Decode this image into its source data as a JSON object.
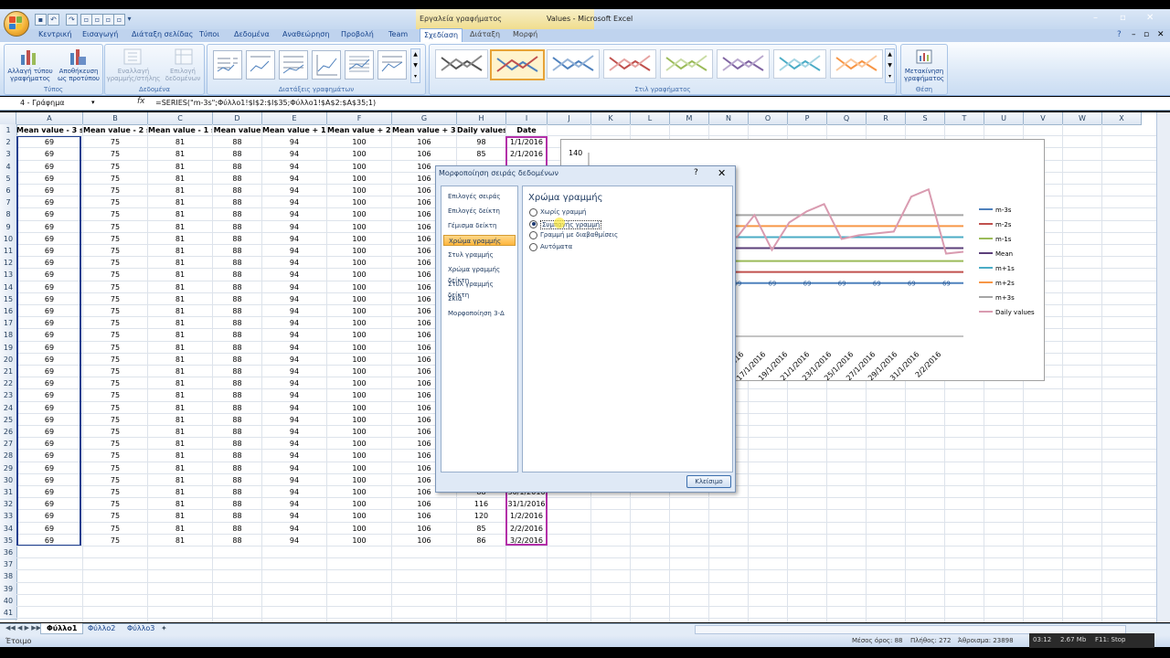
{
  "window": {
    "title": "Values - Microsoft Excel",
    "chart_tools_label": "Εργαλεία γραφήματος"
  },
  "tabs": [
    {
      "label": "Κεντρική"
    },
    {
      "label": "Εισαγωγή"
    },
    {
      "label": "Διάταξη σελίδας"
    },
    {
      "label": "Τύποι"
    },
    {
      "label": "Δεδομένα"
    },
    {
      "label": "Αναθεώρηση"
    },
    {
      "label": "Προβολή"
    },
    {
      "label": "Team"
    },
    {
      "label": "Σχεδίαση"
    },
    {
      "label": "Διάταξη"
    },
    {
      "label": "Μορφή"
    }
  ],
  "ribbon": {
    "type_group": {
      "label": "Τύπος",
      "change_type": "Αλλαγή τύπου γραφήματος",
      "save_template": "Αποθήκευση ως προτύπου"
    },
    "data_group": {
      "label": "Δεδομένα",
      "switch": "Εναλλαγή γραμμής/στήλης",
      "select": "Επιλογή δεδομένων"
    },
    "layouts_label": "Διατάξεις γραφημάτων",
    "styles_label": "Στιλ γραφήματος",
    "location_group": {
      "label": "Θέση",
      "move": "Μετακίνηση γραφήματος"
    }
  },
  "formula_bar": {
    "name_box": "4 - Γράφημα",
    "fx": "fx",
    "formula": "=SERIES(\"m-3s\";Φύλλο1!$I$2:$I$35;Φύλλο1!$A$2:$A$35;1)"
  },
  "sheet": {
    "columns": [
      "A",
      "B",
      "C",
      "D",
      "E",
      "F",
      "G",
      "H",
      "I",
      "J",
      "K",
      "L",
      "M",
      "N",
      "O",
      "P",
      "Q",
      "R",
      "S",
      "T",
      "U",
      "V",
      "W",
      "X"
    ],
    "headers": [
      "Mean value - 3 s",
      "Mean value - 2 s",
      "Mean value - 1 s",
      "Mean value",
      "Mean value + 1 s",
      "Mean value + 2 s",
      "Mean value + 3 s",
      "Daily values",
      "Date"
    ],
    "rows": [
      {
        "n": "2",
        "a": "69",
        "b": "75",
        "c": "81",
        "d": "88",
        "e": "94",
        "f": "100",
        "g": "106",
        "h": "98",
        "i": "1/1/2016"
      },
      {
        "n": "3",
        "a": "69",
        "b": "75",
        "c": "81",
        "d": "88",
        "e": "94",
        "f": "100",
        "g": "106",
        "h": "85",
        "i": "2/1/2016"
      },
      {
        "n": "4",
        "a": "69",
        "b": "75",
        "c": "81",
        "d": "88",
        "e": "94",
        "f": "100",
        "g": "106",
        "h": "",
        "i": ""
      },
      {
        "n": "5",
        "a": "69",
        "b": "75",
        "c": "81",
        "d": "88",
        "e": "94",
        "f": "100",
        "g": "106",
        "h": "",
        "i": ""
      },
      {
        "n": "6",
        "a": "69",
        "b": "75",
        "c": "81",
        "d": "88",
        "e": "94",
        "f": "100",
        "g": "106",
        "h": "",
        "i": ""
      },
      {
        "n": "7",
        "a": "69",
        "b": "75",
        "c": "81",
        "d": "88",
        "e": "94",
        "f": "100",
        "g": "106",
        "h": "",
        "i": ""
      },
      {
        "n": "8",
        "a": "69",
        "b": "75",
        "c": "81",
        "d": "88",
        "e": "94",
        "f": "100",
        "g": "106",
        "h": "",
        "i": ""
      },
      {
        "n": "9",
        "a": "69",
        "b": "75",
        "c": "81",
        "d": "88",
        "e": "94",
        "f": "100",
        "g": "106",
        "h": "",
        "i": ""
      },
      {
        "n": "10",
        "a": "69",
        "b": "75",
        "c": "81",
        "d": "88",
        "e": "94",
        "f": "100",
        "g": "106",
        "h": "",
        "i": ""
      },
      {
        "n": "11",
        "a": "69",
        "b": "75",
        "c": "81",
        "d": "88",
        "e": "94",
        "f": "100",
        "g": "106",
        "h": "",
        "i": ""
      },
      {
        "n": "12",
        "a": "69",
        "b": "75",
        "c": "81",
        "d": "88",
        "e": "94",
        "f": "100",
        "g": "106",
        "h": "",
        "i": ""
      },
      {
        "n": "13",
        "a": "69",
        "b": "75",
        "c": "81",
        "d": "88",
        "e": "94",
        "f": "100",
        "g": "106",
        "h": "",
        "i": ""
      },
      {
        "n": "14",
        "a": "69",
        "b": "75",
        "c": "81",
        "d": "88",
        "e": "94",
        "f": "100",
        "g": "106",
        "h": "",
        "i": ""
      },
      {
        "n": "15",
        "a": "69",
        "b": "75",
        "c": "81",
        "d": "88",
        "e": "94",
        "f": "100",
        "g": "106",
        "h": "",
        "i": ""
      },
      {
        "n": "16",
        "a": "69",
        "b": "75",
        "c": "81",
        "d": "88",
        "e": "94",
        "f": "100",
        "g": "106",
        "h": "",
        "i": ""
      },
      {
        "n": "17",
        "a": "69",
        "b": "75",
        "c": "81",
        "d": "88",
        "e": "94",
        "f": "100",
        "g": "106",
        "h": "",
        "i": ""
      },
      {
        "n": "18",
        "a": "69",
        "b": "75",
        "c": "81",
        "d": "88",
        "e": "94",
        "f": "100",
        "g": "106",
        "h": "",
        "i": ""
      },
      {
        "n": "19",
        "a": "69",
        "b": "75",
        "c": "81",
        "d": "88",
        "e": "94",
        "f": "100",
        "g": "106",
        "h": "",
        "i": ""
      },
      {
        "n": "20",
        "a": "69",
        "b": "75",
        "c": "81",
        "d": "88",
        "e": "94",
        "f": "100",
        "g": "106",
        "h": "",
        "i": ""
      },
      {
        "n": "21",
        "a": "69",
        "b": "75",
        "c": "81",
        "d": "88",
        "e": "94",
        "f": "100",
        "g": "106",
        "h": "",
        "i": ""
      },
      {
        "n": "22",
        "a": "69",
        "b": "75",
        "c": "81",
        "d": "88",
        "e": "94",
        "f": "100",
        "g": "106",
        "h": "",
        "i": ""
      },
      {
        "n": "23",
        "a": "69",
        "b": "75",
        "c": "81",
        "d": "88",
        "e": "94",
        "f": "100",
        "g": "106",
        "h": "",
        "i": ""
      },
      {
        "n": "24",
        "a": "69",
        "b": "75",
        "c": "81",
        "d": "88",
        "e": "94",
        "f": "100",
        "g": "106",
        "h": "",
        "i": ""
      },
      {
        "n": "25",
        "a": "69",
        "b": "75",
        "c": "81",
        "d": "88",
        "e": "94",
        "f": "100",
        "g": "106",
        "h": "",
        "i": ""
      },
      {
        "n": "26",
        "a": "69",
        "b": "75",
        "c": "81",
        "d": "88",
        "e": "94",
        "f": "100",
        "g": "106",
        "h": "",
        "i": ""
      },
      {
        "n": "27",
        "a": "69",
        "b": "75",
        "c": "81",
        "d": "88",
        "e": "94",
        "f": "100",
        "g": "106",
        "h": "",
        "i": ""
      },
      {
        "n": "28",
        "a": "69",
        "b": "75",
        "c": "81",
        "d": "88",
        "e": "94",
        "f": "100",
        "g": "106",
        "h": "",
        "i": ""
      },
      {
        "n": "29",
        "a": "69",
        "b": "75",
        "c": "81",
        "d": "88",
        "e": "94",
        "f": "100",
        "g": "106",
        "h": "",
        "i": ""
      },
      {
        "n": "30",
        "a": "69",
        "b": "75",
        "c": "81",
        "d": "88",
        "e": "94",
        "f": "100",
        "g": "106",
        "h": "",
        "i": ""
      },
      {
        "n": "31",
        "a": "69",
        "b": "75",
        "c": "81",
        "d": "88",
        "e": "94",
        "f": "100",
        "g": "106",
        "h": "88",
        "i": "30/1/2016"
      },
      {
        "n": "32",
        "a": "69",
        "b": "75",
        "c": "81",
        "d": "88",
        "e": "94",
        "f": "100",
        "g": "106",
        "h": "116",
        "i": "31/1/2016"
      },
      {
        "n": "33",
        "a": "69",
        "b": "75",
        "c": "81",
        "d": "88",
        "e": "94",
        "f": "100",
        "g": "106",
        "h": "120",
        "i": "1/2/2016"
      },
      {
        "n": "34",
        "a": "69",
        "b": "75",
        "c": "81",
        "d": "88",
        "e": "94",
        "f": "100",
        "g": "106",
        "h": "85",
        "i": "2/2/2016"
      },
      {
        "n": "35",
        "a": "69",
        "b": "75",
        "c": "81",
        "d": "88",
        "e": "94",
        "f": "100",
        "g": "106",
        "h": "86",
        "i": "3/2/2016"
      }
    ],
    "empty_rows": [
      "36",
      "37",
      "38",
      "39",
      "40",
      "41"
    ]
  },
  "chart_data": {
    "type": "line",
    "y_tick_visible": "140",
    "x_tick_labels": [
      "15/1/2016",
      "17/1/2016",
      "19/1/2016",
      "21/1/2016",
      "23/1/2016",
      "25/1/2016",
      "27/1/2016",
      "29/1/2016",
      "31/1/2016",
      "2/2/2016"
    ],
    "x_tick_first_visible_text": "2016",
    "legend_position": "right",
    "series": [
      {
        "name": "m-3s",
        "value": 69,
        "color": "#4f81bd"
      },
      {
        "name": "m-2s",
        "value": 75,
        "color": "#c0504d"
      },
      {
        "name": "m-1s",
        "value": 81,
        "color": "#9bbb59"
      },
      {
        "name": "Mean",
        "value": 88,
        "color": "#5b3f7a"
      },
      {
        "name": "m+1s",
        "value": 94,
        "color": "#4bacc6"
      },
      {
        "name": "m+2s",
        "value": 100,
        "color": "#f79646"
      },
      {
        "name": "m+3s",
        "value": 106,
        "color": "#a5a5a5"
      },
      {
        "name": "Daily values",
        "color": "#d99bb0",
        "values": [
          85,
          89,
          92,
          94,
          92,
          95,
          93,
          96,
          94,
          106,
          87,
          102,
          108,
          112,
          93,
          95,
          96,
          97,
          116,
          120,
          85,
          86
        ]
      }
    ],
    "m3s_data_label": "69"
  },
  "dialog": {
    "title": "Μορφοποίηση σειράς δεδομένων",
    "help": "?",
    "close_x": "✕",
    "categories": [
      {
        "label": "Επιλογές σειράς"
      },
      {
        "label": "Επιλογές δείκτη"
      },
      {
        "label": "Γέμισμα δείκτη"
      },
      {
        "label": "Χρώμα γραμμής"
      },
      {
        "label": "Στυλ γραμμής"
      },
      {
        "label": "Χρώμα γραμμής δείκτη"
      },
      {
        "label": "Στυλ γραμμής δείκτη"
      },
      {
        "label": "Σκιά"
      },
      {
        "label": "Μορφοποίηση 3-Δ"
      }
    ],
    "selected_index": 3,
    "heading": "Χρώμα γραμμής",
    "options": [
      {
        "label": "Χωρίς γραμμή"
      },
      {
        "label": "Συμπαγής γραμμή"
      },
      {
        "label": "Γραμμή με διαβαθμίσεις"
      },
      {
        "label": "Αυτόματα"
      }
    ],
    "selected_option": 1,
    "close_button": "Κλείσιμο"
  },
  "sheet_tabs": [
    {
      "label": "Φύλλο1"
    },
    {
      "label": "Φύλλο2"
    },
    {
      "label": "Φύλλο3"
    }
  ],
  "status": {
    "ready": "Έτοιμο",
    "average": "Μέσος όρος: 88",
    "count": "Πλήθος: 272",
    "sum": "Άθροισμα: 23898",
    "overlay_time": "03:12",
    "overlay_size": "2.67 Mb",
    "overlay_stop": "F11: Stop"
  }
}
